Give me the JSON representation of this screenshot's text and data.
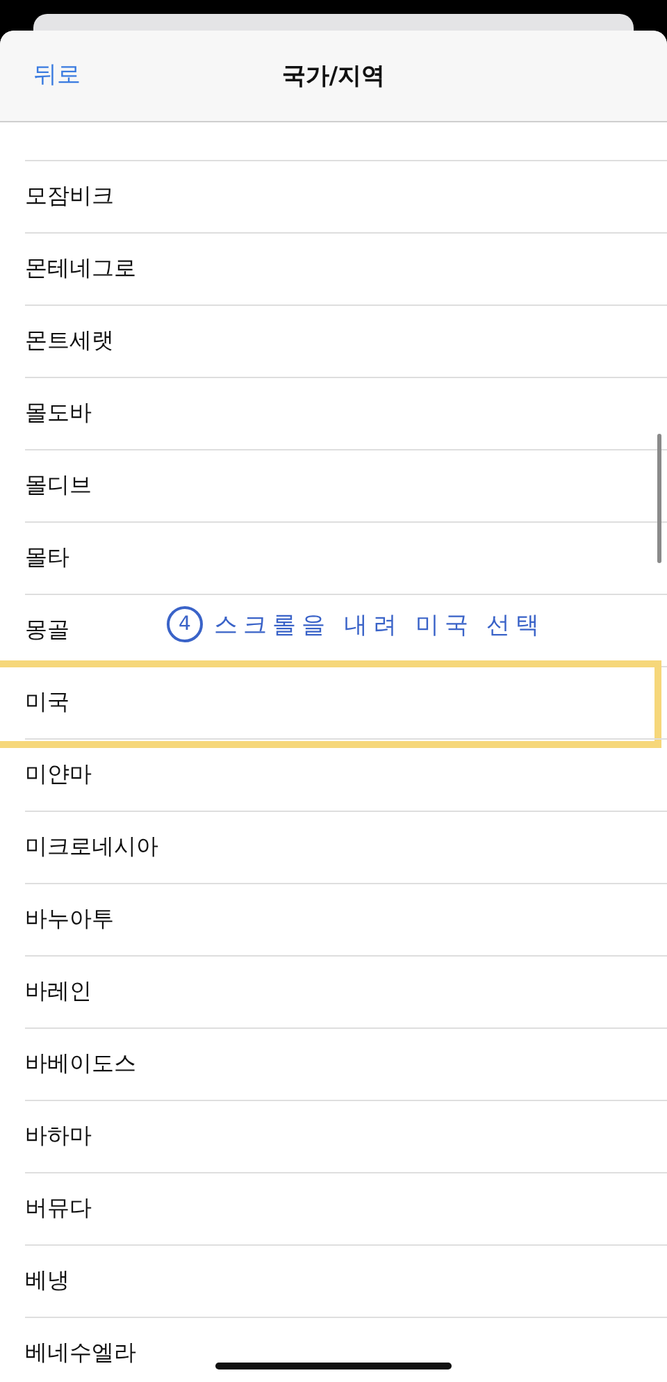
{
  "header": {
    "back": "뒤로",
    "title": "국가/지역"
  },
  "rows": [
    {
      "label": "모잠비크",
      "highlighted": false
    },
    {
      "label": "몬테네그로",
      "highlighted": false
    },
    {
      "label": "몬트세랫",
      "highlighted": false
    },
    {
      "label": "몰도바",
      "highlighted": false
    },
    {
      "label": "몰디브",
      "highlighted": false
    },
    {
      "label": "몰타",
      "highlighted": false
    },
    {
      "label": "몽골",
      "highlighted": false
    },
    {
      "label": "미국",
      "highlighted": true
    },
    {
      "label": "미얀마",
      "highlighted": false
    },
    {
      "label": "미크로네시아",
      "highlighted": false
    },
    {
      "label": "바누아투",
      "highlighted": false
    },
    {
      "label": "바레인",
      "highlighted": false
    },
    {
      "label": "바베이도스",
      "highlighted": false
    },
    {
      "label": "바하마",
      "highlighted": false
    },
    {
      "label": "버뮤다",
      "highlighted": false
    },
    {
      "label": "베냉",
      "highlighted": false
    },
    {
      "label": "베네수엘라",
      "highlighted": false
    }
  ],
  "annotation": {
    "step": "4",
    "text": "스크롤을 내려 미국 선택"
  }
}
